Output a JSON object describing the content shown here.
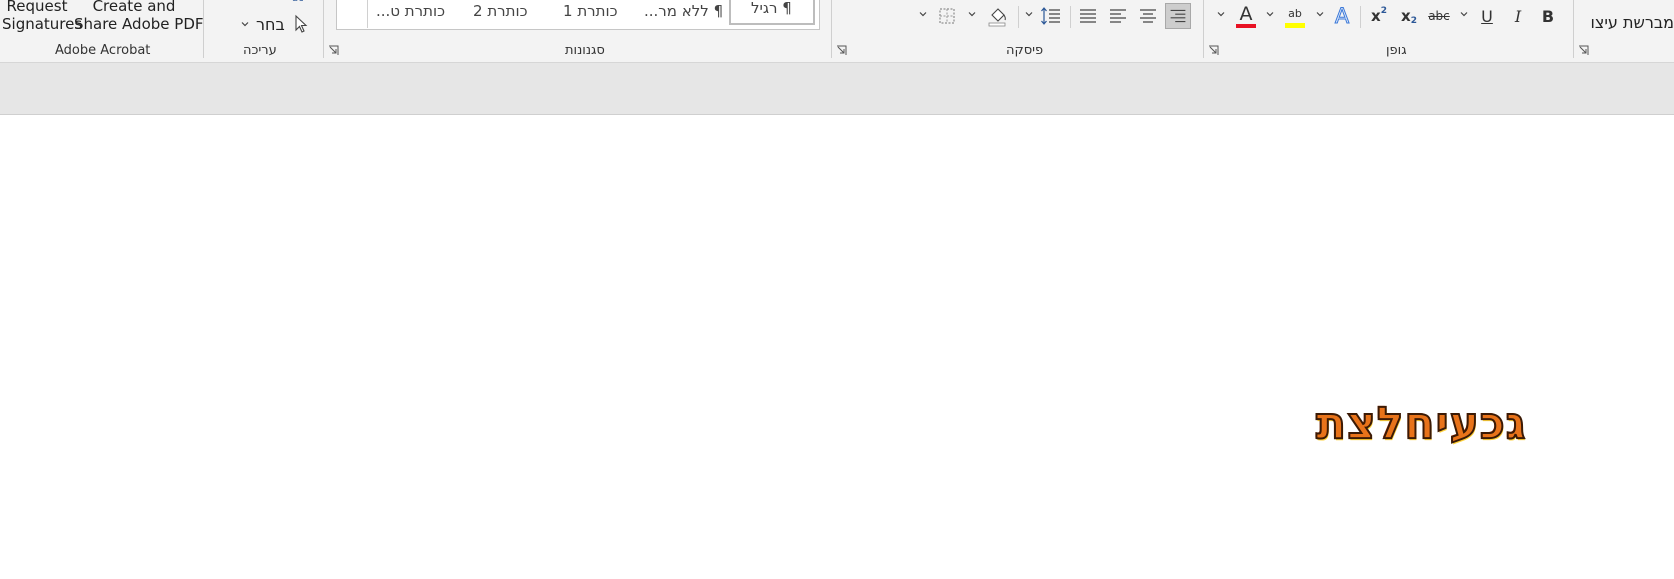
{
  "ribbon": {
    "acrobat": {
      "group_label": "Adobe Acrobat",
      "request_signatures": [
        "Request",
        "Signatures"
      ],
      "create_share": [
        "Create and",
        "Share Adobe PDF"
      ]
    },
    "editing": {
      "group_label": "עריכה",
      "select_label": "בחר",
      "replace_fragment": "ac"
    },
    "styles": {
      "group_label": "סגנונות",
      "items": [
        "¶ רגיל",
        "¶ ללא מר...",
        "כותרת 1",
        "כותרת 2",
        "כותרת ט..."
      ]
    },
    "paragraph": {
      "group_label": "פיסקה"
    },
    "font": {
      "group_label": "גופן",
      "bold": "B",
      "italic": "I",
      "underline": "U",
      "strikethrough": "abc",
      "text_effects": "A",
      "font_color": "A",
      "highlight": "ab",
      "subscript": "x",
      "subscript_mark": "2",
      "superscript": "x",
      "superscript_mark": "2",
      "font_color_hex": "#e81123",
      "highlight_hex": "#ffff00"
    },
    "format_painter_label": "מברשת עיצוב"
  },
  "document": {
    "word": "גכעיחלצת"
  }
}
